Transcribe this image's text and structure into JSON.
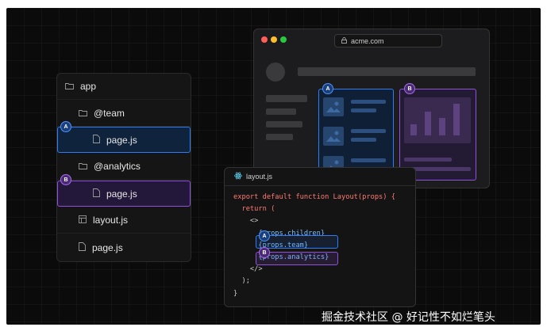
{
  "file_tree": {
    "items": [
      {
        "label": "app",
        "icon": "folder-icon"
      },
      {
        "label": "@team",
        "icon": "folder-icon"
      },
      {
        "label": "page.js",
        "icon": "file-icon",
        "slot": "A"
      },
      {
        "label": "@analytics",
        "icon": "folder-icon"
      },
      {
        "label": "page.js",
        "icon": "file-icon",
        "slot": "B"
      },
      {
        "label": "layout.js",
        "icon": "layout-file-icon"
      },
      {
        "label": "page.js",
        "icon": "file-icon"
      }
    ]
  },
  "slots": {
    "a": "A",
    "b": "B"
  },
  "browser": {
    "url": "acme.com"
  },
  "code_window": {
    "filename": "layout.js",
    "lines": [
      "export default function Layout(props) {",
      "  return (",
      "    <>",
      "      {props.children}",
      "      {props.team}",
      "      {props.analytics}",
      "    </>",
      "  );",
      "}"
    ]
  },
  "watermark": "掘金技术社区 @ 好记性不如烂笔头",
  "colors": {
    "slot_a": "#2f7df6",
    "slot_b": "#8e52db",
    "background": "#0b0b0c"
  }
}
